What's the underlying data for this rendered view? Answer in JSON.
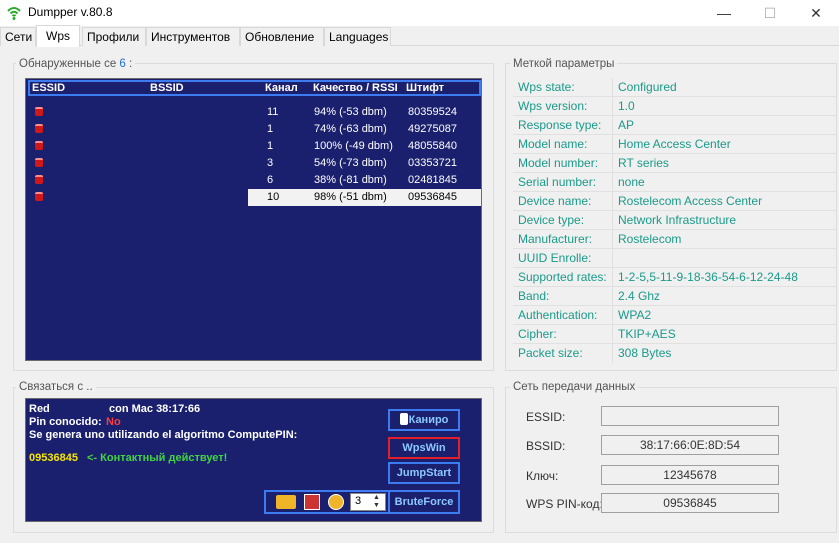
{
  "window": {
    "title": "Dumpper v.80.8",
    "controls": {
      "minimize": "—",
      "maximize": "☐",
      "close": "✕"
    }
  },
  "tabs": [
    "Сети",
    "Wps",
    "Профили",
    "Инструментов",
    "Обновление",
    "Languages"
  ],
  "active_tab": "Wps",
  "networks": {
    "group_title": "Обнаруженные се",
    "count": "6",
    "count_suffix": " :",
    "columns": [
      "ESSID",
      "BSSID",
      "Канал",
      "Качество / RSSI",
      "Штифт"
    ],
    "rows": [
      {
        "channel": "11",
        "quality": "94% (-53 dbm)",
        "pin": "80359524"
      },
      {
        "channel": "1",
        "quality": "74% (-63 dbm)",
        "pin": "49275087"
      },
      {
        "channel": "1",
        "quality": "100% (-49 dbm)",
        "pin": "48055840"
      },
      {
        "channel": "3",
        "quality": "54% (-73 dbm)",
        "pin": "03353721"
      },
      {
        "channel": "6",
        "quality": "38% (-81 dbm)",
        "pin": "02481845"
      },
      {
        "channel": "10",
        "quality": "98% (-51 dbm)",
        "pin": "09536845",
        "selected": true
      }
    ]
  },
  "params": {
    "group_title": "Меткой параметры",
    "rows": [
      {
        "key": "Wps state:",
        "value": "Configured"
      },
      {
        "key": "Wps version:",
        "value": "1.0"
      },
      {
        "key": "Response type:",
        "value": "AP"
      },
      {
        "key": "Model name:",
        "value": "Home Access Center"
      },
      {
        "key": "Model number:",
        "value": "RT series"
      },
      {
        "key": "Serial number:",
        "value": "none"
      },
      {
        "key": "Device name:",
        "value": "Rostelecom Access Center"
      },
      {
        "key": "Device type:",
        "value": "Network Infrastructure"
      },
      {
        "key": "Manufacturer:",
        "value": "Rostelecom"
      },
      {
        "key": "UUID Enrolle:",
        "value": ""
      },
      {
        "key": "Supported rates:",
        "value": "1-2-5,5-11-9-18-36-54-6-12-24-48"
      },
      {
        "key": "Band:",
        "value": "2.4 Ghz"
      },
      {
        "key": "Authentication:",
        "value": "WPA2"
      },
      {
        "key": "Cipher:",
        "value": "TKIP+AES"
      },
      {
        "key": "Packet size:",
        "value": "308 Bytes"
      }
    ]
  },
  "connect": {
    "group_title": "Связаться с ..",
    "line1_a": "Red",
    "line1_b": "con Mac 38:17:66",
    "pin_known_label": "Pin conocido:",
    "pin_known_value": "No",
    "line3": "Se genera uno utilizando el algoritmo ComputePIN:",
    "pin": "09536845",
    "pin_status": "<- Контактный действует!",
    "buttons": {
      "scan": "Каниро",
      "wpswin": "WpsWin",
      "jumpstart": "JumpStart",
      "bruteforce": "BruteForce"
    },
    "spinner_value": "3"
  },
  "transfer": {
    "group_title": "Сеть передачи данных",
    "fields": [
      {
        "label": "ESSID:",
        "value": ""
      },
      {
        "label": "BSSID:",
        "value": "38:17:66:0E:8D:54"
      },
      {
        "label": "Ключ:",
        "value": "12345678"
      },
      {
        "label": "WPS PIN-код:",
        "value": "09536845"
      }
    ]
  }
}
